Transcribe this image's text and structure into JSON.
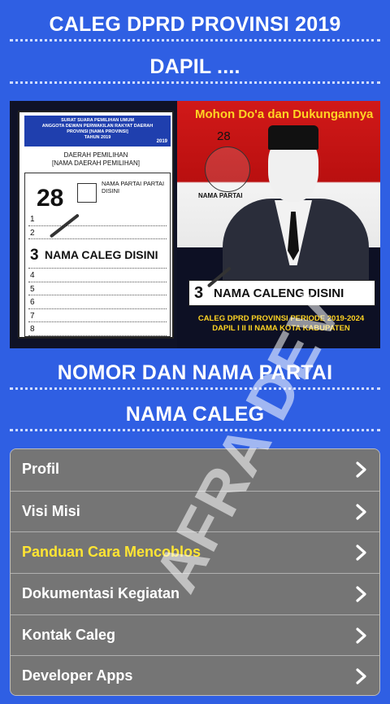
{
  "header": {
    "title": "CALEG DPRD PROVINSI 2019",
    "dapil": "DAPIL ...."
  },
  "banner": {
    "ballot": {
      "head_lines": [
        "SURAT SUARA PEMILIHAN UMUM",
        "ANGGOTA DEWAN PERWAKILAN RAKYAT DAERAH",
        "PROVINSI [NAMA PROVINSI]",
        "TAHUN 2019"
      ],
      "year": "2019",
      "daerah_label": "DAERAH PEMILIHAN",
      "daerah_value": "[NAMA DAERAH PEMILIHAN]",
      "party_number": "28",
      "party_name": "NAMA PARTAI PARTAI DISINI",
      "rows": [
        "1",
        "2",
        "3",
        "4",
        "5",
        "6",
        "7",
        "8"
      ],
      "selected_row": "3",
      "selected_name": "NAMA CALEG DISINI"
    },
    "mohon_text": "Mohon Do'a dan Dukungannya",
    "number": "28",
    "party_label": "NAMA PARTAI",
    "namebar_number": "3",
    "namebar_text": "NAMA CALENG DISINI",
    "caleg_line1": "CALEG DPRD PROVINSI PERIODE 2019-2024",
    "caleg_line2": "DAPIL I II II NAMA KOTA KABUPATEN"
  },
  "section": {
    "party_title": "NOMOR DAN NAMA PARTAI",
    "caleg_title": "NAMA CALEG"
  },
  "menu": {
    "items": [
      {
        "label": "Profil",
        "highlight": false
      },
      {
        "label": "Visi Misi",
        "highlight": false
      },
      {
        "label": "Panduan Cara Mencoblos",
        "highlight": true
      },
      {
        "label": "Dokumentasi Kegiatan",
        "highlight": false
      },
      {
        "label": "Kontak Caleg",
        "highlight": false
      },
      {
        "label": "Developer Apps",
        "highlight": false
      }
    ],
    "icon": "chevron-right-icon"
  },
  "watermark": "AFRA DEV",
  "colors": {
    "background": "#2f5fe3",
    "menu_bg": "#757575",
    "highlight_text": "#ffe533",
    "banner_yellow": "#ffd423"
  }
}
